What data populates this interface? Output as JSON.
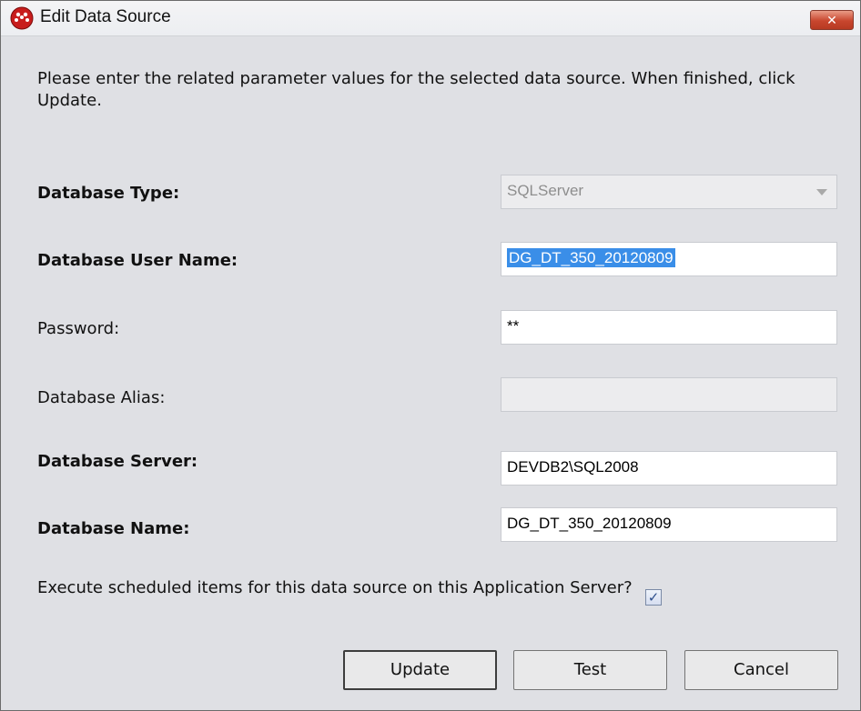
{
  "window": {
    "title": "Edit Data Source",
    "close_label": "✕"
  },
  "instructions": "Please enter the related parameter values for the selected data source. When finished, click Update.",
  "form": {
    "database_type": {
      "label": "Database Type:",
      "value": "SQLServer"
    },
    "user_name": {
      "label": "Database User Name:",
      "value": "DG_DT_350_20120809"
    },
    "password": {
      "label": "Password:",
      "value": "**"
    },
    "alias": {
      "label": "Database Alias:",
      "value": ""
    },
    "server": {
      "label": "Database Server:",
      "value": "DEVDB2\\SQL2008"
    },
    "db_name": {
      "label": "Database Name:",
      "value": "DG_DT_350_20120809"
    },
    "execute_scheduled": {
      "label": "Execute scheduled items for this data source on this Application Server?",
      "checked": true,
      "check_glyph": "✓"
    }
  },
  "buttons": {
    "update": "Update",
    "test": "Test",
    "cancel": "Cancel"
  },
  "colors": {
    "selection": "#3a8ee8",
    "close_button": "#c8462e",
    "dialog_background": "#dfe0e4"
  }
}
